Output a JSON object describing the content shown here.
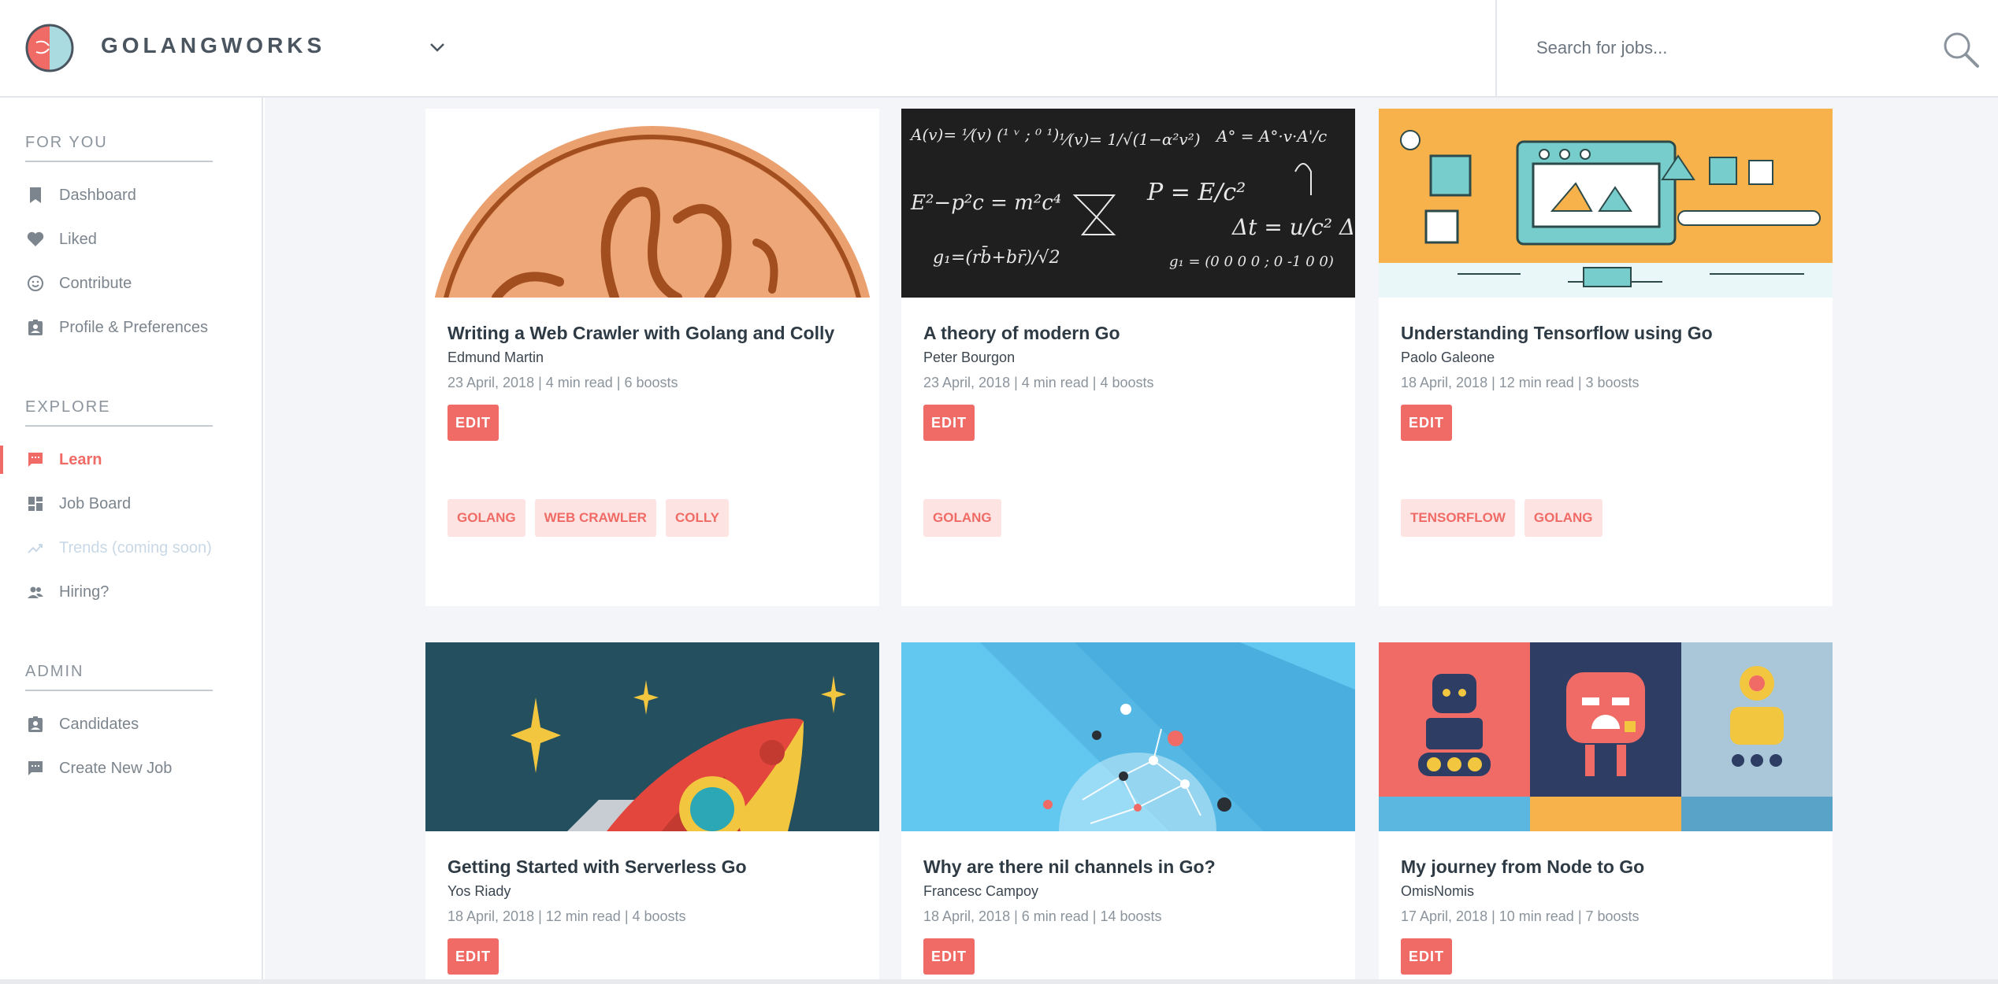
{
  "header": {
    "brand": "GOLANGWORKS",
    "search_placeholder": "Search for jobs..."
  },
  "sidebar": {
    "sections": [
      {
        "title": "FOR YOU",
        "items": [
          {
            "label": "Dashboard",
            "icon": "bookmark-icon"
          },
          {
            "label": "Liked",
            "icon": "heart-icon"
          },
          {
            "label": "Contribute",
            "icon": "smiley-icon"
          },
          {
            "label": "Profile & Preferences",
            "icon": "badge-icon"
          }
        ]
      },
      {
        "title": "EXPLORE",
        "items": [
          {
            "label": "Learn",
            "icon": "chat-icon",
            "active": true
          },
          {
            "label": "Job Board",
            "icon": "dashboard-icon"
          },
          {
            "label": "Trends (coming soon)",
            "icon": "trending-icon",
            "disabled": true
          },
          {
            "label": "Hiring?",
            "icon": "people-icon"
          }
        ]
      },
      {
        "title": "ADMIN",
        "items": [
          {
            "label": "Candidates",
            "icon": "badge-icon"
          },
          {
            "label": "Create New Job",
            "icon": "chat-icon"
          }
        ]
      }
    ]
  },
  "colors": {
    "accent": "#f06b66",
    "tag_bg": "#fde4e3"
  },
  "cards": [
    {
      "title": "Writing a Web Crawler with Golang and Colly",
      "author": "Edmund Martin",
      "meta": "23 April, 2018 | 4 min read | 6 boosts",
      "edit": "EDIT",
      "tags": [
        "GOLANG",
        "WEB CRAWLER",
        "COLLY"
      ],
      "image": "gopher-coin-illustration"
    },
    {
      "title": "A theory of modern Go",
      "author": "Peter Bourgon",
      "meta": "23 April, 2018 | 4 min read | 4 boosts",
      "edit": "EDIT",
      "tags": [
        "GOLANG"
      ],
      "image": "chalkboard-equations-illustration"
    },
    {
      "title": "Understanding Tensorflow using Go",
      "author": "Paolo Galeone",
      "meta": "18 April, 2018 | 12 min read | 3 boosts",
      "edit": "EDIT",
      "tags": [
        "TENSORFLOW",
        "GOLANG"
      ],
      "image": "factory-machine-illustration"
    },
    {
      "title": "Getting Started with Serverless Go",
      "author": "Yos Riady",
      "meta": "18 April, 2018 | 12 min read | 4 boosts",
      "edit": "EDIT",
      "tags": [],
      "image": "rocket-illustration"
    },
    {
      "title": "Why are there nil channels in Go?",
      "author": "Francesc Campoy",
      "meta": "18 April, 2018 | 6 min read | 14 boosts",
      "edit": "EDIT",
      "tags": [],
      "image": "network-globe-illustration"
    },
    {
      "title": "My journey from Node to Go",
      "author": "OmisNomis",
      "meta": "17 April, 2018 | 10 min read | 7 boosts",
      "edit": "EDIT",
      "tags": [],
      "image": "robots-illustration"
    }
  ]
}
